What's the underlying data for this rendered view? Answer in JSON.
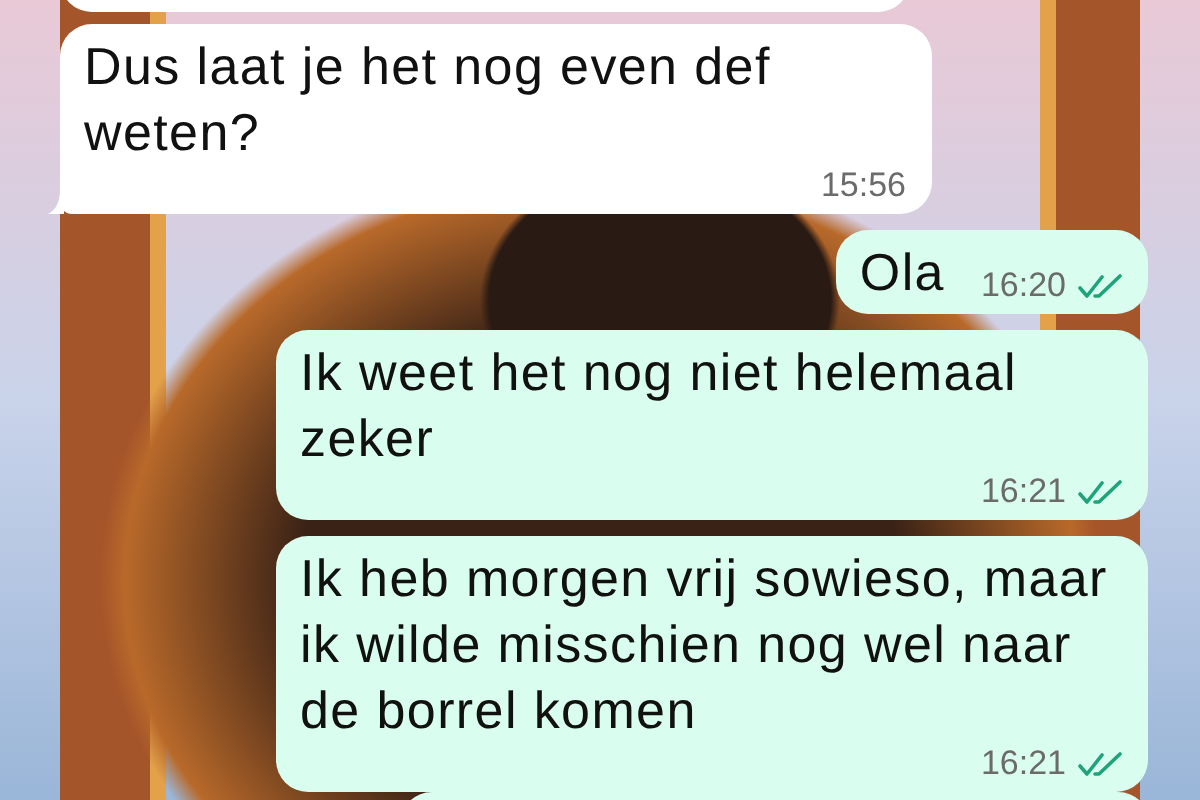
{
  "messages": [
    {
      "kind": "incoming",
      "text": "Dus laat je het nog even def weten?",
      "time": "15:56"
    },
    {
      "kind": "outgoing",
      "text": "Ola",
      "time": "16:20",
      "read": true
    },
    {
      "kind": "outgoing",
      "text": "Ik weet het nog niet helemaal zeker",
      "time": "16:21",
      "read": true
    },
    {
      "kind": "outgoing",
      "text": "Ik heb morgen vrij sowieso, maar ik wilde misschien nog wel naar de borrel komen",
      "time": "16:21",
      "read": true
    }
  ]
}
